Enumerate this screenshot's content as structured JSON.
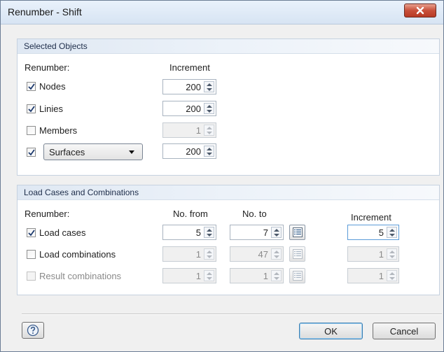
{
  "window": {
    "title": "Renumber - Shift"
  },
  "selected_objects": {
    "heading": "Selected Objects",
    "renumber_label": "Renumber:",
    "increment_header": "Increment",
    "rows": [
      {
        "label": "Nodes",
        "checked": true,
        "increment": "200",
        "enabled": true
      },
      {
        "label": "Linies",
        "checked": true,
        "increment": "200",
        "enabled": true
      },
      {
        "label": "Members",
        "checked": false,
        "increment": "1",
        "enabled": false
      },
      {
        "label": "Surfaces",
        "checked": true,
        "increment": "200",
        "enabled": true,
        "is_dropdown": true
      }
    ]
  },
  "load_cases": {
    "heading": "Load Cases and Combinations",
    "renumber_label": "Renumber:",
    "no_from_header": "No. from",
    "no_to_header": "No. to",
    "increment_header": "Increment",
    "rows": [
      {
        "label": "Load cases",
        "checked": true,
        "enabled": true,
        "no_from": "5",
        "no_to": "7",
        "increment": "5"
      },
      {
        "label": "Load combinations",
        "checked": false,
        "enabled": true,
        "no_from": "1",
        "no_to": "47",
        "increment": "1"
      },
      {
        "label": "Result combinations",
        "checked": false,
        "enabled": false,
        "no_from": "1",
        "no_to": "1",
        "increment": "1"
      }
    ]
  },
  "buttons": {
    "ok": "OK",
    "cancel": "Cancel"
  },
  "icons": {
    "help": "help-icon",
    "close": "close-icon",
    "list": "list-icon"
  }
}
